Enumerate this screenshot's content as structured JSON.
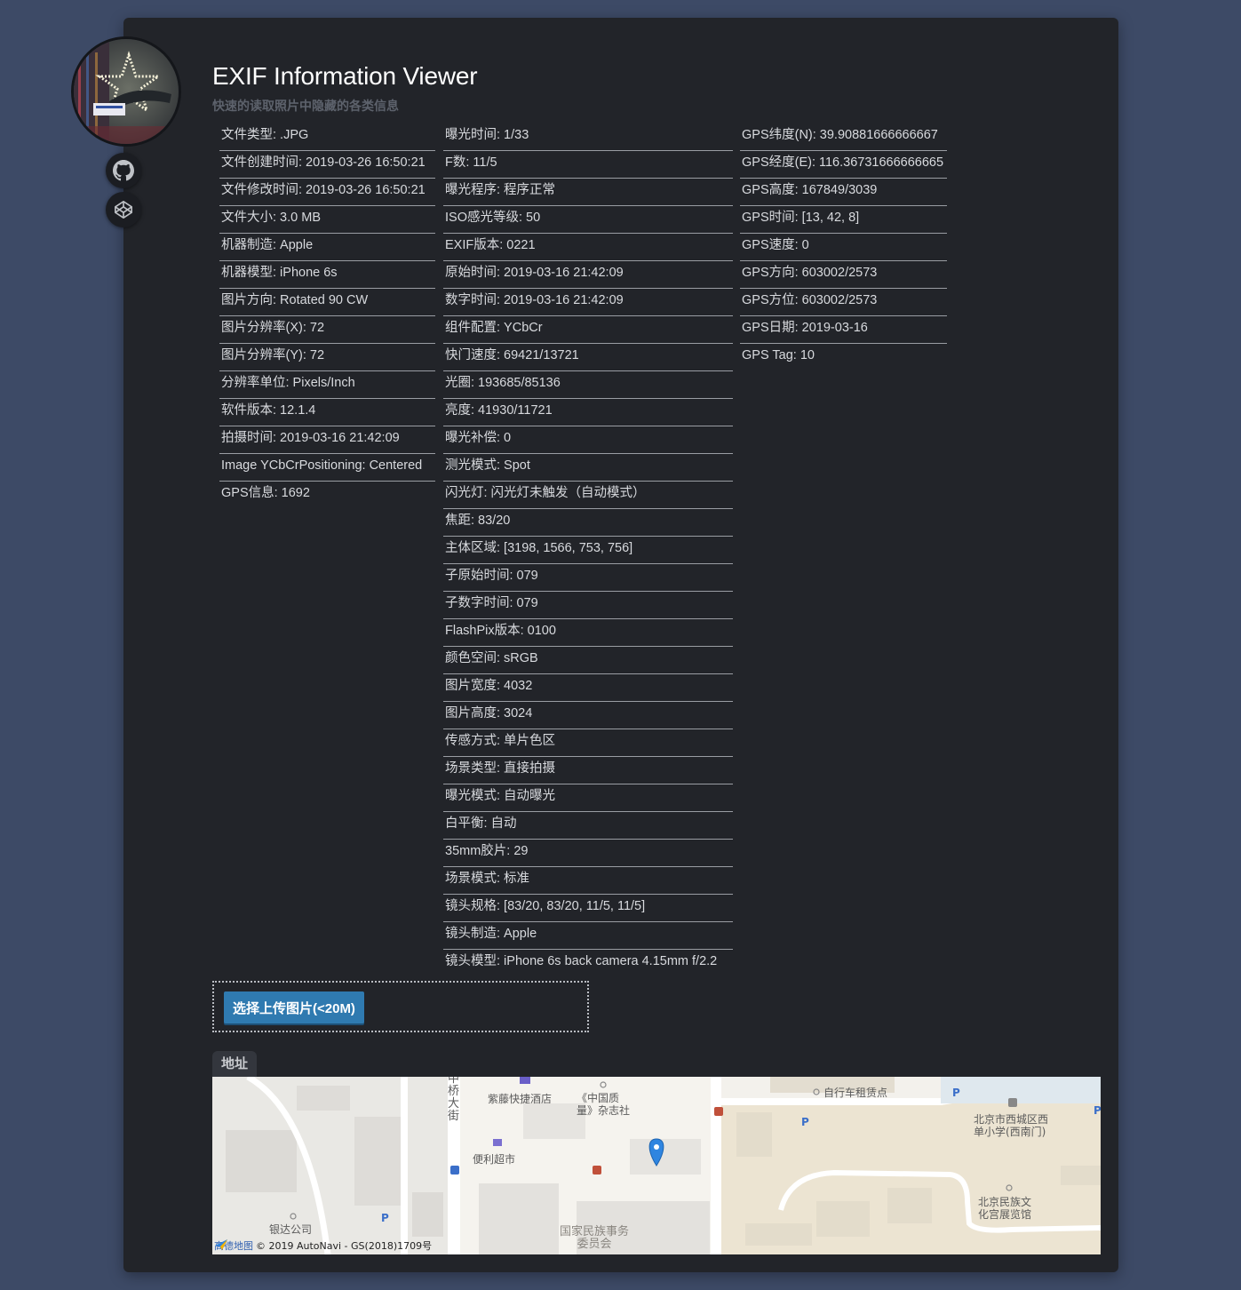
{
  "header": {
    "title": "EXIF Information Viewer",
    "subtitle": "快速的读取照片中隐藏的各类信息"
  },
  "icons": {
    "avatar": "avatar-photo",
    "github": "github-icon",
    "codepen": "codepen-icon",
    "map_pin": "map-pin-icon"
  },
  "colors": {
    "page_bg": "#3d4a66",
    "card_bg": "#222429",
    "upload_button": "#2f7ab0",
    "text": "#d8dade"
  },
  "columns": {
    "left": [
      "文件类型: .JPG",
      "文件创建时间: 2019-03-26 16:50:21",
      "文件修改时间: 2019-03-26 16:50:21",
      "文件大小: 3.0 MB",
      "机器制造: Apple",
      "机器模型: iPhone 6s",
      "图片方向: Rotated 90 CW",
      "图片分辨率(X): 72",
      "图片分辨率(Y): 72",
      "分辨率单位: Pixels/Inch",
      "软件版本: 12.1.4",
      "拍摄时间: 2019-03-16 21:42:09",
      "Image YCbCrPositioning: Centered",
      "GPS信息: 1692"
    ],
    "middle": [
      "曝光时间: 1/33",
      "F数: 11/5",
      "曝光程序: 程序正常",
      "ISO感光等级: 50",
      "EXIF版本: 0221",
      "原始时间: 2019-03-16 21:42:09",
      "数字时间: 2019-03-16 21:42:09",
      "组件配置: YCbCr",
      "快门速度: 69421/13721",
      "光圈: 193685/85136",
      "亮度: 41930/11721",
      "曝光补偿: 0",
      "测光模式: Spot",
      "闪光灯: 闪光灯未触发（自动模式）",
      "焦距: 83/20",
      "主体区域: [3198, 1566, 753, 756]",
      "子原始时间: 079",
      "子数字时间: 079",
      "FlashPix版本: 0100",
      "颜色空间: sRGB",
      "图片宽度: 4032",
      "图片高度: 3024",
      "传感方式: 单片色区",
      "场景类型: 直接拍摄",
      "曝光模式: 自动曝光",
      "白平衡: 自动",
      "35mm胶片: 29",
      "场景模式: 标准",
      "镜头规格: [83/20, 83/20, 11/5, 11/5]",
      "镜头制造: Apple",
      "镜头模型: iPhone 6s back camera 4.15mm f/2.2"
    ],
    "right": [
      "GPS纬度(N): 39.90881666666667",
      "GPS经度(E): 116.36731666666665",
      "GPS高度: 167849/3039",
      "GPS时间: [13, 42, 8]",
      "GPS速度: 0",
      "GPS方向: 603002/2573",
      "GPS方位: 603002/2573",
      "GPS日期: 2019-03-16",
      "GPS Tag: 10"
    ]
  },
  "upload": {
    "button_label": "选择上传图片(<20M)"
  },
  "address": {
    "tab_label": "地址"
  },
  "map": {
    "labels": {
      "street": "中桥大街",
      "hotel": "紫藤快捷酒店",
      "magazine": "《中国质量》杂志社",
      "bike": "自行车租赁点",
      "school": "北京市西城区西单小学(西南门)",
      "store": "便利超市",
      "museum": "北京民族文化宫展览馆",
      "company": "银达公司",
      "commission": "国家民族事务委员会"
    },
    "footer_logo": "高德地图",
    "footer_text": "© 2019 AutoNavi - GS(2018)1709号"
  }
}
